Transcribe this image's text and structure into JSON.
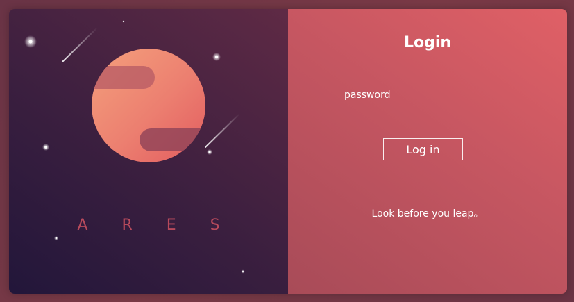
{
  "brand": {
    "name": "A R E S"
  },
  "login": {
    "title": "Login",
    "password_placeholder": "password",
    "password_value": "",
    "submit_label": "Log in",
    "motto": "Look before you leap。"
  },
  "colors": {
    "background": "#6a3446",
    "left_panel": "#3b1f3f",
    "right_panel": "#c55661",
    "planet": "#ec7f70",
    "brand_text": "#b84a5c",
    "text": "#ffffff"
  },
  "icons": {
    "illustration": "planet-illustration",
    "stars": "star-icon",
    "meteors": "meteor-icon"
  }
}
